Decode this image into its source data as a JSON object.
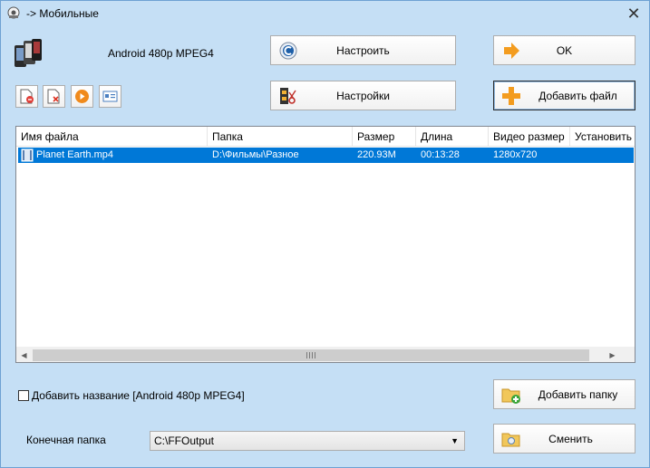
{
  "window": {
    "title": "-> Мобильные",
    "close_glyph": "✕"
  },
  "profile": {
    "label": "Android 480p MPEG4",
    "icon": "phones-icon"
  },
  "buttons": {
    "configure": "Настроить",
    "ok": "OK",
    "settings": "Настройки",
    "add_file": "Добавить файл",
    "add_folder": "Добавить папку",
    "change": "Сменить"
  },
  "toolbar": [
    {
      "icon": "remove-file-icon"
    },
    {
      "icon": "clear-list-icon"
    },
    {
      "icon": "play-icon"
    },
    {
      "icon": "media-info-icon"
    }
  ],
  "file_list": {
    "columns": [
      "Имя файла",
      "Папка",
      "Размер",
      "Длина",
      "Видео размер",
      "Установить д"
    ],
    "rows": [
      {
        "name": "Planet Earth.mp4",
        "folder": "D:\\Фильмы\\Разное",
        "size": "220.93M",
        "length": "00:13:28",
        "video_size": "1280x720",
        "extra": "",
        "selected": true
      }
    ]
  },
  "options": {
    "add_name_label": "Добавить название [Android 480p MPEG4]",
    "add_name_checked": false
  },
  "destination": {
    "label": "Конечная папка",
    "value": "C:\\FFOutput"
  },
  "colors": {
    "window_bg": "#c5dff5",
    "selection": "#0078d7",
    "add_icon_orange": "#f39c1f"
  }
}
